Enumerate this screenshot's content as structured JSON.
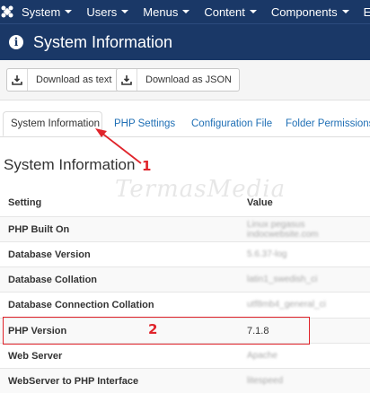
{
  "nav": {
    "items": [
      {
        "label": "System"
      },
      {
        "label": "Users"
      },
      {
        "label": "Menus"
      },
      {
        "label": "Content"
      },
      {
        "label": "Components"
      },
      {
        "label": "Ex"
      }
    ]
  },
  "header": {
    "title": "System Information"
  },
  "toolbar": {
    "download_text": "Download as text",
    "download_json": "Download as JSON"
  },
  "tabs": [
    {
      "label": "System Information",
      "active": true
    },
    {
      "label": "PHP Settings"
    },
    {
      "label": "Configuration File"
    },
    {
      "label": "Folder Permissions"
    }
  ],
  "section_title": "System Information",
  "table": {
    "headers": {
      "setting": "Setting",
      "value": "Value"
    },
    "rows": [
      {
        "setting": "PHP Built On",
        "value": "Linux pegasus indocwebsite.com"
      },
      {
        "setting": "Database Version",
        "value": "5.6.37-log"
      },
      {
        "setting": "Database Collation",
        "value": "latin1_swedish_ci"
      },
      {
        "setting": "Database Connection Collation",
        "value": "utf8mb4_general_ci"
      },
      {
        "setting": "PHP Version",
        "value": "7.1.8"
      },
      {
        "setting": "Web Server",
        "value": "Apache"
      },
      {
        "setting": "WebServer to PHP Interface",
        "value": "litespeed"
      }
    ]
  },
  "annotations": {
    "marker1": "1",
    "marker2": "2"
  },
  "watermark": "TermasMedia",
  "colors": {
    "nav_bg": "#1a3867",
    "link": "#1f6fb5",
    "highlight": "#e0242b"
  }
}
